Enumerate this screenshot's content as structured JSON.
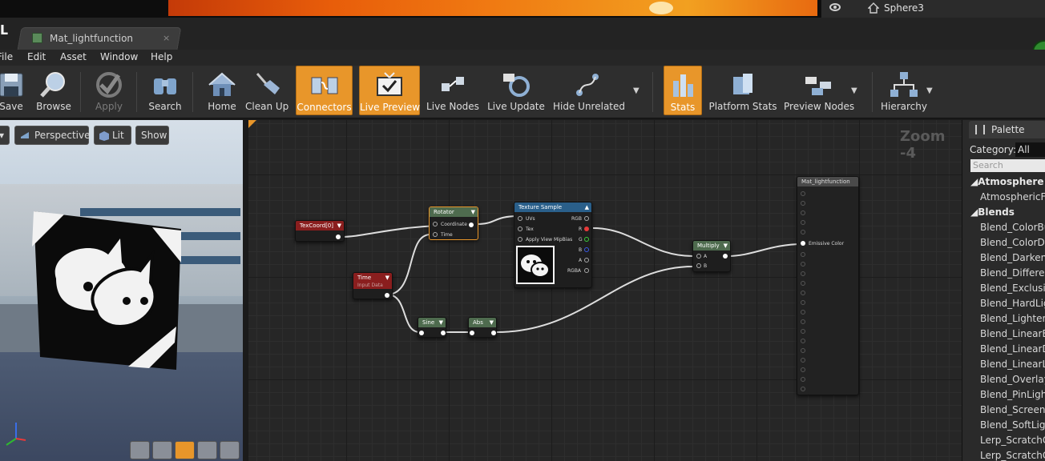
{
  "outliner": {
    "actor": "Sphere3"
  },
  "tab": {
    "title": "Mat_lightfunction",
    "close": "×"
  },
  "menu": [
    "File",
    "Edit",
    "Asset",
    "Window",
    "Help"
  ],
  "toolbar": {
    "save": "Save",
    "browse": "Browse",
    "apply": "Apply",
    "search": "Search",
    "home": "Home",
    "cleanup": "Clean Up",
    "connectors": "Connectors",
    "live_preview": "Live Preview",
    "live_nodes": "Live Nodes",
    "live_update": "Live Update",
    "hide_unrelated": "Hide Unrelated",
    "stats": "Stats",
    "platform_stats": "Platform Stats",
    "preview_nodes": "Preview Nodes",
    "hierarchy": "Hierarchy"
  },
  "viewport": {
    "perspective": "Perspective",
    "lit": "Lit",
    "show": "Show"
  },
  "graph": {
    "zoom": "Zoom -4",
    "texcoord": "TexCoord[0]",
    "rotator": {
      "title": "Rotator",
      "coordinate": "Coordinate",
      "time": "Time"
    },
    "time": {
      "title": "Time",
      "sub": "Input Data"
    },
    "sine": "Sine",
    "abs": "Abs",
    "texsample": {
      "title": "Texture Sample",
      "uvs": "UVs",
      "tex": "Tex",
      "mipbias": "Apply View MipBias",
      "rgb": "RGB",
      "r": "R",
      "g": "G",
      "b": "B",
      "a": "A",
      "rgba": "RGBA"
    },
    "multiply": {
      "title": "Multiply",
      "a": "A",
      "b": "B"
    },
    "result": {
      "title": "Mat_lightfunction",
      "emissive": "Emissive Color"
    }
  },
  "palette": {
    "tab": "Palette",
    "category_label": "Category:",
    "category_value": "All",
    "search_placeholder": "Search",
    "sections": [
      {
        "name": "Atmosphere",
        "items": [
          "AtmosphericFo"
        ]
      },
      {
        "name": "Blends",
        "items": [
          "Blend_ColorBu",
          "Blend_ColorDo",
          "Blend_Darken",
          "Blend_Differen",
          "Blend_Exclusio",
          "Blend_HardLigh",
          "Blend_Lighten",
          "Blend_LinearB",
          "Blend_LinearD",
          "Blend_LinearLi",
          "Blend_Overlay",
          "Blend_PinLight",
          "Blend_Screen",
          "Blend_SoftLigh",
          "Lerp_ScratchG",
          "Lerp_ScratchG"
        ]
      }
    ]
  },
  "colors": {
    "accent": "#e8962a",
    "fire": "#e85d0a"
  }
}
